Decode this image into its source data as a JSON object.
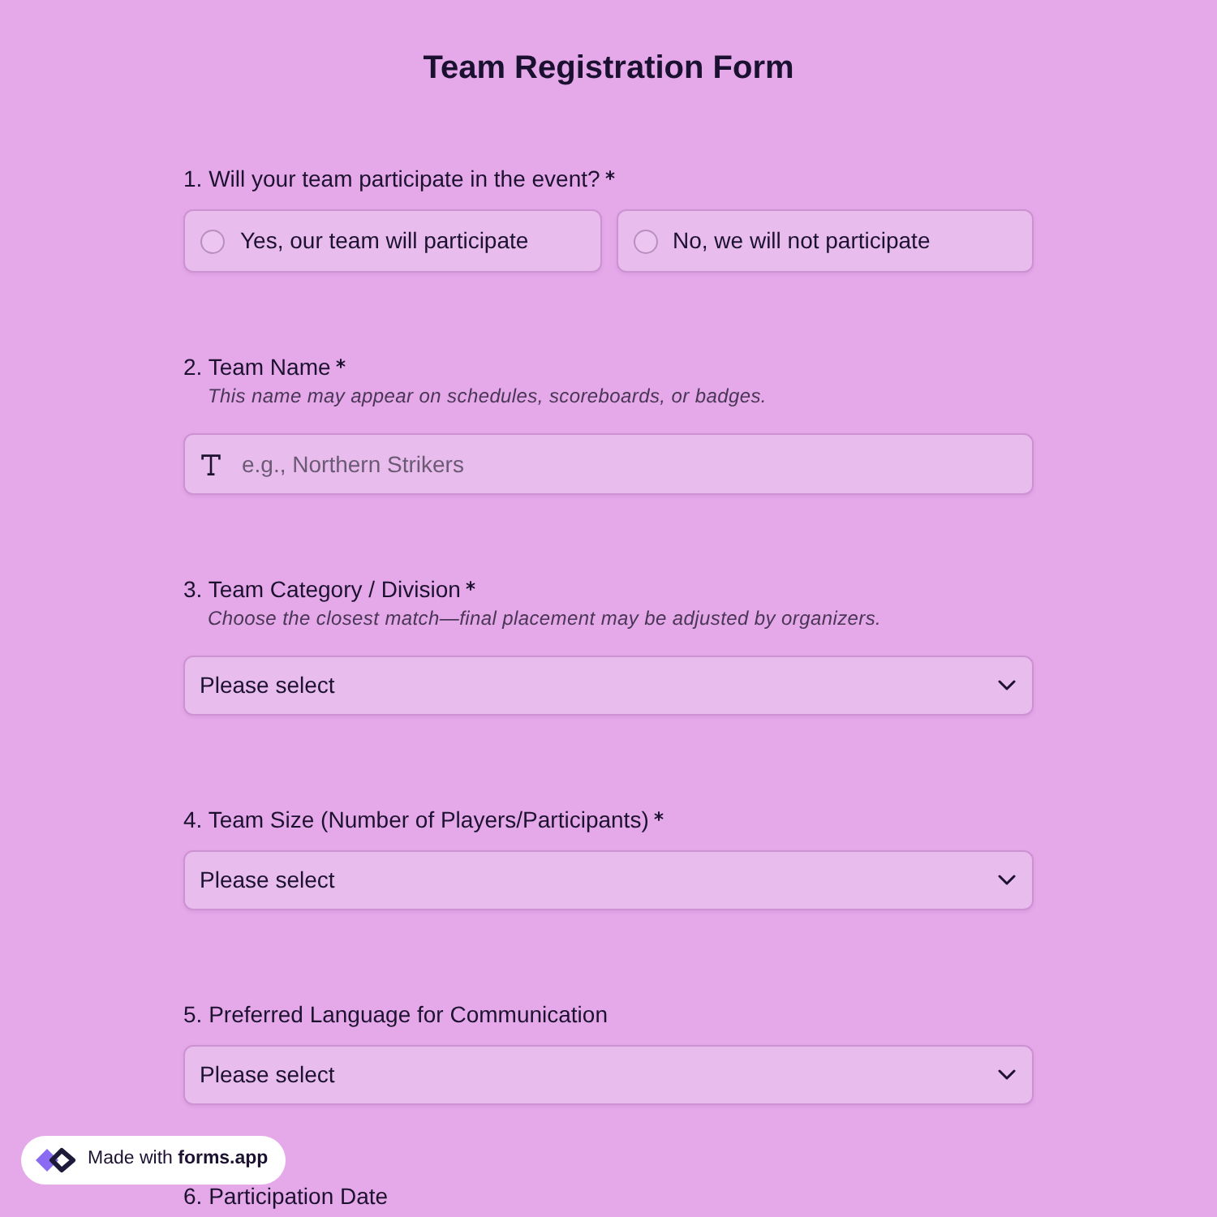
{
  "title": "Team Registration Form",
  "questions": [
    {
      "kind": "radio",
      "label": "1. Will your team participate in the event?",
      "required": true,
      "options": [
        {
          "label": "Yes, our team will participate",
          "selected": false
        },
        {
          "label": "No, we will not participate",
          "selected": false
        }
      ]
    },
    {
      "kind": "text",
      "label": "2. Team Name",
      "required": true,
      "help": "This name may appear on schedules, scoreboards, or badges.",
      "placeholder": "e.g., Northern Strikers"
    },
    {
      "kind": "select",
      "label": "3. Team Category / Division",
      "required": true,
      "help": "Choose the closest match—final placement may be adjusted by organizers.",
      "placeholder": "Please select"
    },
    {
      "kind": "select",
      "label": "4. Team Size (Number of Players/Participants)",
      "required": true,
      "placeholder": "Please select"
    },
    {
      "kind": "select",
      "label": "5. Preferred Language for Communication",
      "required": false,
      "placeholder": "Please select"
    },
    {
      "kind": "cut",
      "label": "6. Participation Date",
      "required": false
    }
  ],
  "badge": {
    "text": "Made with **forms.app**"
  }
}
